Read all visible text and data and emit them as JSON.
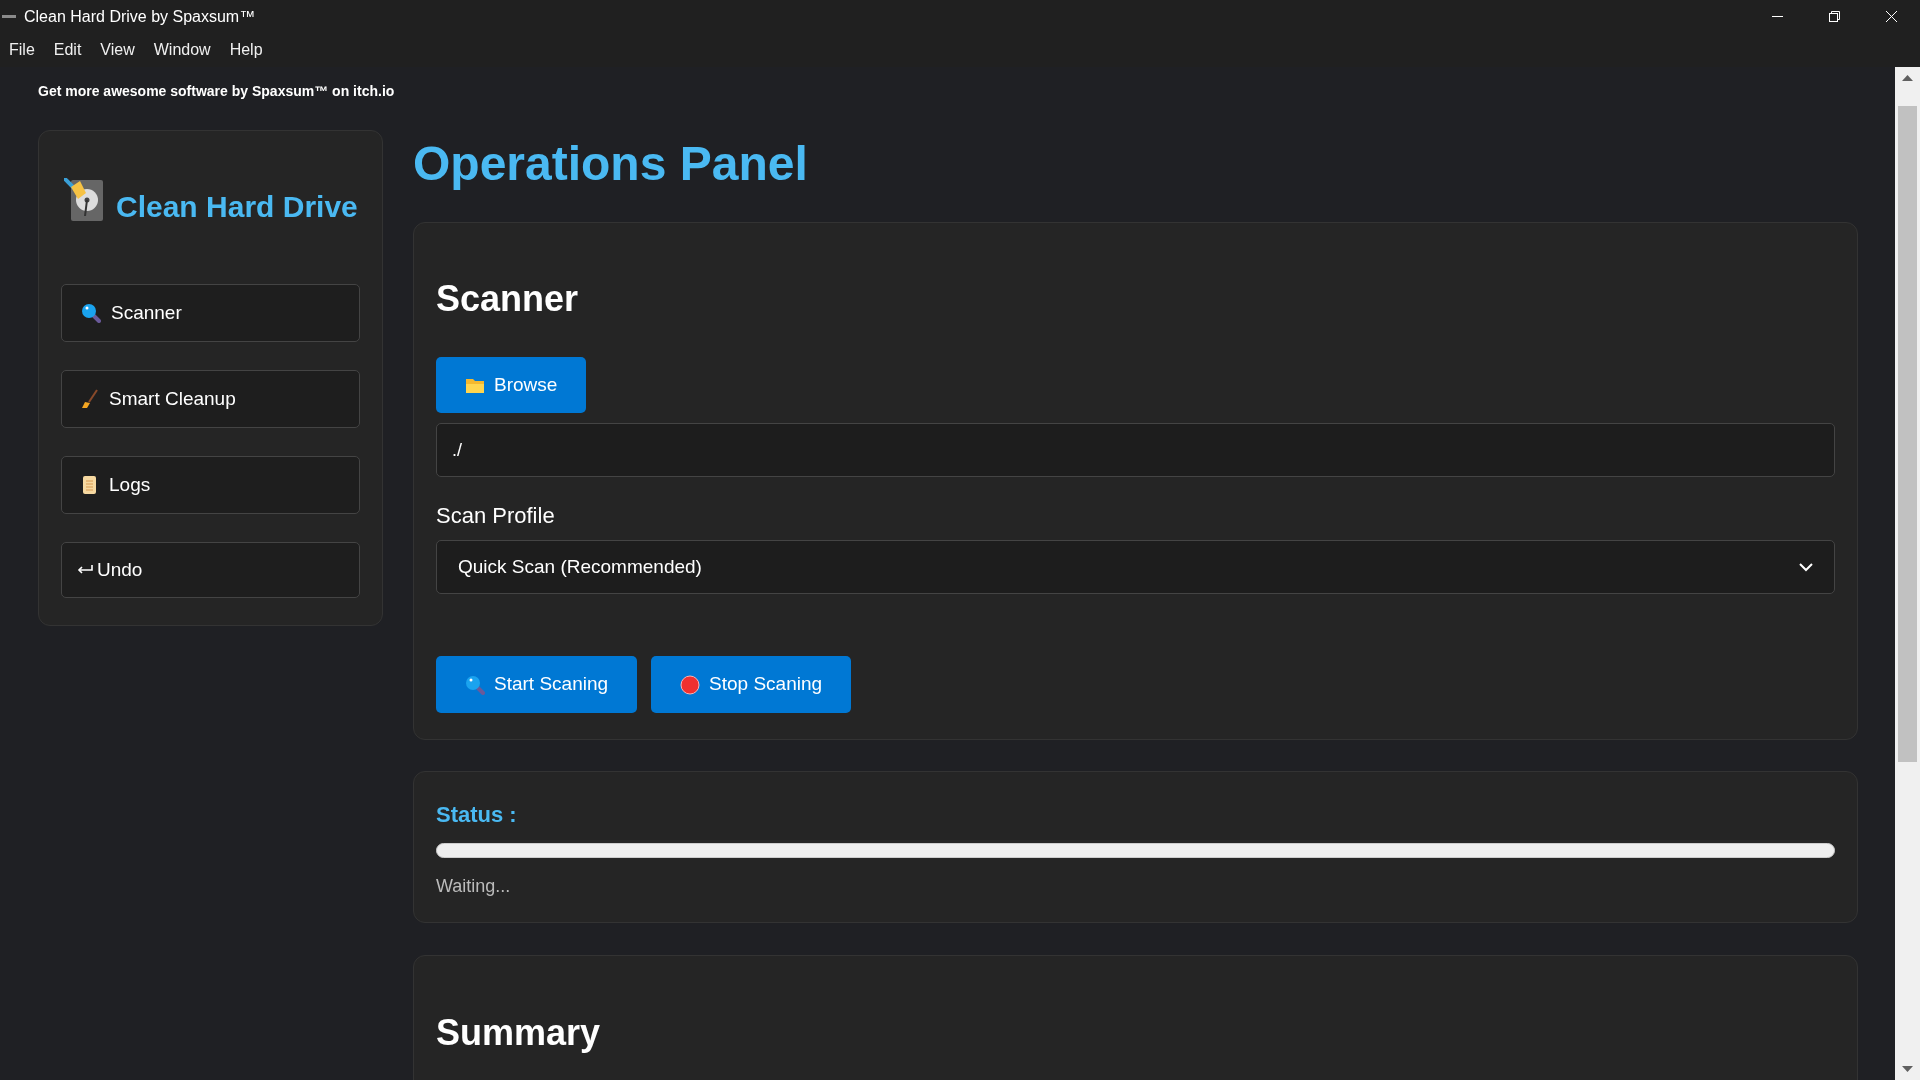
{
  "window": {
    "title": "Clean Hard Drive by Spaxsum™"
  },
  "menu": [
    "File",
    "Edit",
    "View",
    "Window",
    "Help"
  ],
  "banner": "Get more awesome software by Spaxsum™ on itch.io",
  "sidebar": {
    "title": "Clean Hard Drive",
    "items": [
      {
        "label": "Scanner"
      },
      {
        "label": "Smart Cleanup"
      },
      {
        "label": "Logs"
      },
      {
        "label": "Undo"
      }
    ]
  },
  "heading": "Operations Panel",
  "scanner": {
    "title": "Scanner",
    "browse": "Browse",
    "path": "./",
    "profile_label": "Scan Profile",
    "profile": "Quick Scan (Recommended)",
    "actions": [
      {
        "label": "Start Scaning"
      },
      {
        "label": "Stop Scaning"
      }
    ]
  },
  "status": {
    "title": "Status :",
    "level": 0,
    "message": "Waiting..."
  },
  "summary": {
    "title": "Summary"
  }
}
